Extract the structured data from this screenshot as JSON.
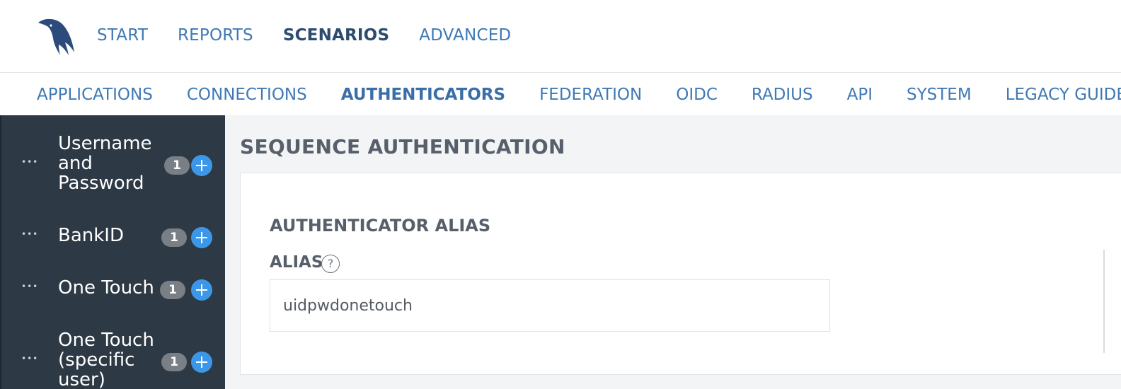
{
  "header": {
    "logo": "bird-logo",
    "nav": [
      {
        "label": "START",
        "active": false
      },
      {
        "label": "REPORTS",
        "active": false
      },
      {
        "label": "SCENARIOS",
        "active": true
      },
      {
        "label": "ADVANCED",
        "active": false
      }
    ]
  },
  "subnav": {
    "items": [
      {
        "label": "APPLICATIONS",
        "active": false
      },
      {
        "label": "CONNECTIONS",
        "active": false
      },
      {
        "label": "AUTHENTICATORS",
        "active": true
      },
      {
        "label": "FEDERATION",
        "active": false
      },
      {
        "label": "OIDC",
        "active": false
      },
      {
        "label": "RADIUS",
        "active": false
      },
      {
        "label": "API",
        "active": false
      },
      {
        "label": "SYSTEM",
        "active": false
      },
      {
        "label": "LEGACY GUIDES",
        "active": false
      }
    ]
  },
  "sidebar": {
    "items": [
      {
        "label": "Username and Password",
        "count": "1"
      },
      {
        "label": "BankID",
        "count": "1"
      },
      {
        "label": "One Touch",
        "count": "1"
      },
      {
        "label": "One Touch (specific user)",
        "count": "1"
      }
    ]
  },
  "main": {
    "title": "SEQUENCE AUTHENTICATION",
    "panel": {
      "subtitle": "AUTHENTICATOR ALIAS",
      "alias_label": "ALIAS",
      "help_glyph": "?",
      "alias_value": "uidpwdonetouch"
    }
  },
  "colors": {
    "accent": "#3f79b5",
    "active_nav": "#2c4b6e",
    "sidebar_bg": "#2d3945",
    "badge_bg": "#7a7f85",
    "add_button": "#3d97e8",
    "main_bg": "#f3f4f6"
  }
}
